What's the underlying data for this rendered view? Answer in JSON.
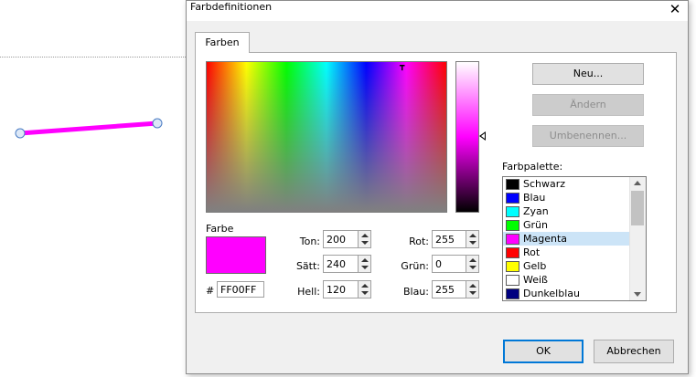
{
  "dialog": {
    "title": "Farbdefinitionen",
    "close_glyph": "✕",
    "tab_label": "Farben"
  },
  "color": {
    "label": "Farbe",
    "hex_prefix": "#",
    "hex_value": "FF00FF",
    "current_hex": "#ff00ff"
  },
  "hsl": [
    {
      "label": "Ton:",
      "value": "200"
    },
    {
      "label": "Sätt:",
      "value": "240"
    },
    {
      "label": "Hell:",
      "value": "120"
    }
  ],
  "rgb": [
    {
      "label": "Rot:",
      "value": "255"
    },
    {
      "label": "Grün:",
      "value": "0"
    },
    {
      "label": "Blau:",
      "value": "255"
    }
  ],
  "buttons": {
    "new": "Neu...",
    "change": "Ändern",
    "rename": "Umbenennen...",
    "ok": "OK",
    "cancel": "Abbrechen"
  },
  "palette": {
    "label": "Farbpalette:",
    "selected_index": 4,
    "items": [
      {
        "name": "Schwarz",
        "color": "#000000"
      },
      {
        "name": "Blau",
        "color": "#0000ff"
      },
      {
        "name": "Zyan",
        "color": "#00ffff"
      },
      {
        "name": "Grün",
        "color": "#00ff00"
      },
      {
        "name": "Magenta",
        "color": "#ff00ff"
      },
      {
        "name": "Rot",
        "color": "#ff0000"
      },
      {
        "name": "Gelb",
        "color": "#ffff00"
      },
      {
        "name": "Weiß",
        "color": "#ffffff"
      },
      {
        "name": "Dunkelblau",
        "color": "#000080"
      }
    ]
  },
  "colors": {
    "accent": "#0078d7",
    "line": "#ff00ff"
  }
}
